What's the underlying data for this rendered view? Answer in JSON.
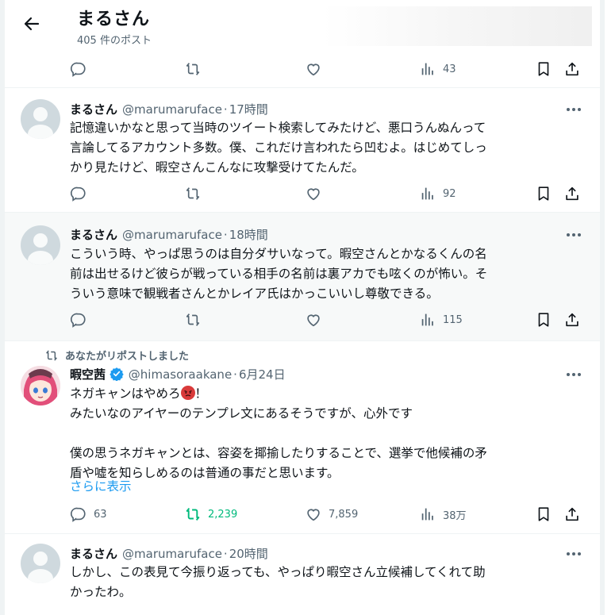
{
  "header": {
    "title": "まるさん",
    "subtitle": "405 件のポスト"
  },
  "top_actions": {
    "views": "43"
  },
  "tweets": [
    {
      "name": "まるさん",
      "handle": "@marumaruface",
      "time": "17時間",
      "lines": [
        "記憶違いかなと思って当時のツイート検索してみたけど、悪口うんぬんって",
        "言論してるアカウント多数。僕、これだけ言われたら凹むよ。はじめてしっ",
        "かり見たけど、暇空さんこんなに攻撃受けてたんだ。"
      ],
      "views": "92"
    },
    {
      "name": "まるさん",
      "handle": "@marumaruface",
      "time": "18時間",
      "lines": [
        "こういう時、やっぱ思うのは自分ダサいなって。暇空さんとかなるくんの名",
        "前は出せるけど彼らが戦っている相手の名前は裏アカでも呟くのが怖い。そ",
        "ういう意味で観戦者さんとかレイア氏はかっこいいし尊敬できる。"
      ],
      "views": "115"
    },
    {
      "repost_label": "あなたがリポストしました",
      "name": "暇空茜",
      "handle": "@himasoraakane",
      "time": "6月24日",
      "line1": "ネガキャンはやめろ",
      "line1_end": "！",
      "line2": "みたいなのアイヤーのテンプレ文にあるそうですが、心外です",
      "line3": "僕の思うネガキャンとは、容姿を揶揄したりすることで、選挙で他候補の矛",
      "line4": "盾や嘘を知らしめるのは普通の事だと思います。",
      "show_more": "さらに表示",
      "replies": "63",
      "reposts": "2,239",
      "likes": "7,859",
      "views": "38万"
    },
    {
      "name": "まるさん",
      "handle": "@marumaruface",
      "time": "20時間",
      "lines": [
        "しかし、この表見て今振り返っても、やっぱり暇空さん立候補してくれて助",
        "かったわ。"
      ]
    }
  ],
  "colors": {
    "text": "#0f1419",
    "muted": "#536471",
    "link": "#1d9bf0",
    "retweet_active": "#00ba7c",
    "verified": "#1d9bf0"
  }
}
